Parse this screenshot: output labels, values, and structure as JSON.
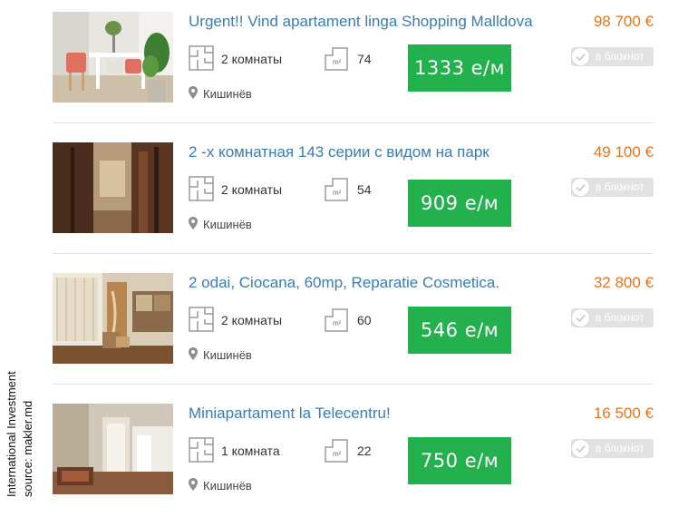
{
  "caption": {
    "line1": "International Investment",
    "line2": "source: makler.md"
  },
  "listings": [
    {
      "title": "Urgent!! Vind apartament linga Shopping Malldova",
      "price": "98 700 €",
      "rooms": "2 комнаты",
      "area": "74",
      "city": "Кишинёв",
      "price_per_m": "1333 е/м",
      "notebook": "в блокнот"
    },
    {
      "title": "2 -х комнатная 143 серии с видом на парк",
      "price": "49 100 €",
      "rooms": "2 комнаты",
      "area": "54",
      "city": "Кишинёв",
      "price_per_m": "909 е/м",
      "notebook": "в блокнот"
    },
    {
      "title": "2 odai, Ciocana, 60mp, Reparatie Cosmetica.",
      "price": "32 800 €",
      "rooms": "2 комнаты",
      "area": "60",
      "city": "Кишинёв",
      "price_per_m": "546 е/м",
      "notebook": "в блокнот"
    },
    {
      "title": "Miniapartament la Telecentru!",
      "price": "16 500 €",
      "rooms": "1 комната",
      "area": "22",
      "city": "Кишинёв",
      "price_per_m": "750 е/м",
      "notebook": "в блокнот"
    }
  ],
  "area_unit": "m²",
  "icons": {
    "rooms": "floorplan-icon",
    "area": "area-icon",
    "location": "map-pin-icon",
    "notebook": "check-circle-icon"
  },
  "colors": {
    "title": "#3b7cb3",
    "price": "#e8741c",
    "price_per_m_bg": "#23b14d",
    "notebook_bg": "#e2e2e2"
  }
}
